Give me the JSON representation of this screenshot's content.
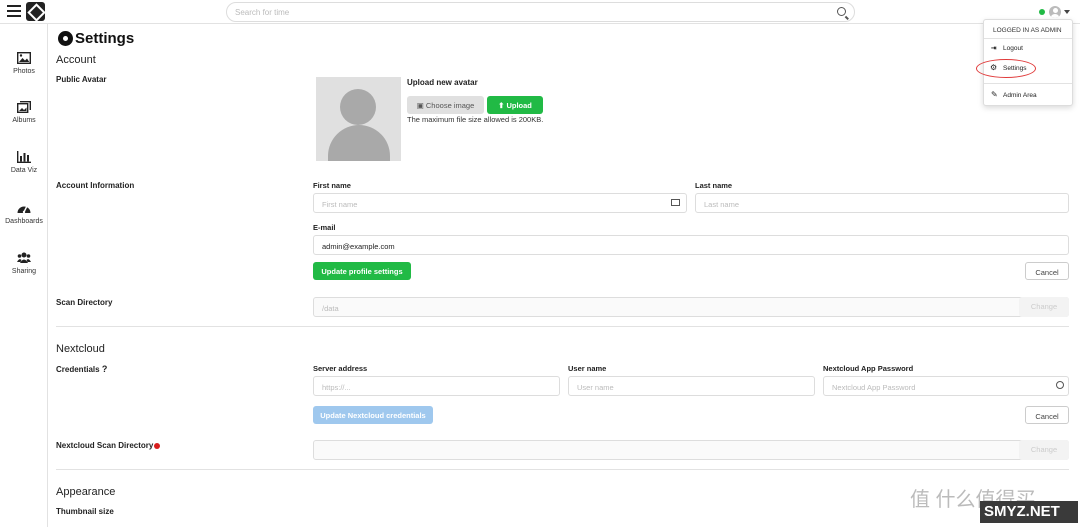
{
  "topbar": {
    "search_placeholder": "Search for time"
  },
  "sidebar": {
    "items": [
      {
        "label": "Photos"
      },
      {
        "label": "Albums"
      },
      {
        "label": "Data Viz"
      },
      {
        "label": "Dashboards"
      },
      {
        "label": "Sharing"
      }
    ]
  },
  "settings": {
    "title": "Settings",
    "account": {
      "heading": "Account",
      "public_avatar_label": "Public Avatar",
      "upload_heading": "Upload new avatar",
      "choose_image_label": "Choose image",
      "upload_label": "Upload",
      "max_size_note": "The maximum file size allowed is 200KB.",
      "account_info_label": "Account Information",
      "first_name_label": "First name",
      "first_name_placeholder": "First name",
      "last_name_label": "Last name",
      "last_name_placeholder": "Last name",
      "email_label": "E-mail",
      "email_value": "admin@example.com",
      "update_profile_label": "Update profile settings",
      "cancel_label": "Cancel",
      "scan_directory_label": "Scan Directory",
      "scan_directory_value": "/data",
      "change_label": "Change"
    },
    "nextcloud": {
      "heading": "Nextcloud",
      "credentials_label": "Credentials",
      "help_mark": "?",
      "server_address_label": "Server address",
      "server_address_placeholder": "https://...",
      "user_name_label": "User name",
      "user_name_placeholder": "User name",
      "app_password_label": "Nextcloud App Password",
      "app_password_placeholder": "Nextcloud App Password",
      "update_credentials_label": "Update Nextcloud credentials",
      "cancel_label": "Cancel",
      "scan_directory_label": "Nextcloud Scan Directory",
      "change_label": "Change"
    },
    "appearance": {
      "heading": "Appearance",
      "thumbnail_size_label": "Thumbnail size"
    }
  },
  "user_menu": {
    "header": "LOGGED IN AS ADMIN",
    "items": [
      {
        "label": "Logout",
        "icon": "logout-icon"
      },
      {
        "label": "Settings",
        "icon": "gear-icon"
      },
      {
        "label": "Admin Area",
        "icon": "wrench-icon"
      }
    ]
  },
  "colors": {
    "accent_green": "#21ba45",
    "disabled_blue": "#9fc8ee",
    "annotation_red": "#e03b3b"
  },
  "watermark": {
    "text": "值 什么值得买",
    "badge": "SMYZ.NET"
  }
}
